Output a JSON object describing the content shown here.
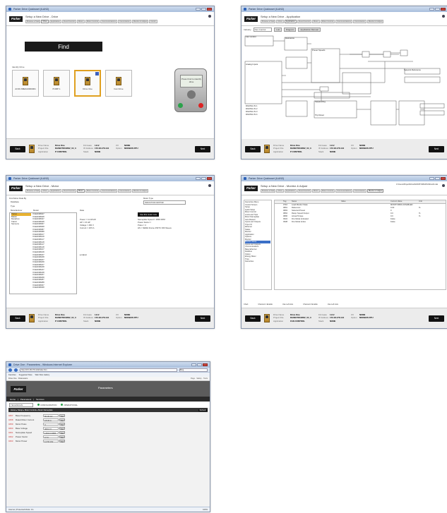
{
  "w1": {
    "title": "Parker Drive Quicksset (ILAN3)",
    "subtitle": "Setup a New Drive - Drive",
    "tabs": [
      "Browse a Task",
      "Drive",
      "Application",
      "Fixed Control",
      "Motor",
      "Motor Control",
      "Communications",
      "Commission",
      "Monitor & Adjust",
      "Finish"
    ],
    "find": "Find",
    "identify": "Identify Drive",
    "tiles": [
      "AC30-S8E0A0000001",
      "PUMP 1",
      "Drive One",
      "Fan Drive"
    ],
    "keypad": "Press Find to identify drive"
  },
  "w2": {
    "title": "Parker Drive Quicksset (ILAN3)",
    "subtitle": "Setup a New Drive - Application",
    "industry_label": "Industry",
    "industry": "Fan Control",
    "list_btn": "List",
    "diagram_btn": "Diagram",
    "manual_btn": "Application Manual",
    "fan_control": "Fan Control",
    "reference": "Reference",
    "preset_speeds": "Preset Speeds",
    "sequencing": "Sequencing",
    "trip_reset": "Trip Reset",
    "setpoint": "Setpoint Reference",
    "digital_inputs": [
      "DIGITAL IN 1",
      "DIGITAL IN 2",
      "DIGITAL IN 3",
      "DIGITAL IN 4"
    ],
    "analog": "Analog Inputs"
  },
  "w3": {
    "title": "Parker Drive Quicksset (ILAN3)",
    "subtitle": "Setup a New Drive - Motor",
    "search_hdr": "Find Motor Data By",
    "search_opts": [
      "Database",
      "Type"
    ],
    "motor_type_hdr": "Motor Type",
    "motor_type": "INDUCTION MOTOR",
    "col_manufacturer": "Manufacturer",
    "col_model": "Model",
    "col_data": "Data",
    "manufacturers": [
      "Parker",
      "Baldor",
      "Marathon",
      "TECO",
      "Siemens"
    ],
    "models": [
      "XCE4008027",
      "XCE4008028",
      "XCE4008047",
      "XCE4008048",
      "XCE4008067",
      "XCE4008068",
      "XCE4008087",
      "XCE4008088",
      "XCE4008107",
      "XCE4008108",
      "XCE4008127",
      "XCE4008128",
      "XCE4008147",
      "XCE4008148",
      "XCE4008167",
      "XCE4008168",
      "XCE4008187",
      "XCE4008188",
      "XCE4008207",
      "XCE4008208",
      "XCE4008227",
      "XCE4008228",
      "XCE4008247",
      "XCE4008248",
      "XCE4008267",
      "XCE4008268",
      "XCE4008287",
      "XCE4008288",
      "XCE4008307",
      "XCE4008308"
    ],
    "data_left": [
      "Power = 11.18 kW",
      "HP = 15 HP",
      "Voltage = 460 V",
      "Current = 18.5 A"
    ],
    "data_right": [
      "Nameplate Speed = 1800 RPM",
      "Power Factor =",
      "Poles = 4",
      "HS = NEMA Frame 254TC DIN Sleeve"
    ],
    "adjust": "Adjust",
    "nameplate_btn": "Use this motor now"
  },
  "w4": {
    "title": "Parker Drive Quicksset (ILAN3)",
    "subtitle": "Setup a New Drive - Monitor & Adjust",
    "path": "C:\\Users\\Project\\Drive\\MONITORDATA\\Drive01.dat",
    "tree": [
      "Favourites Menu",
      "Control Screen",
      "Setup",
      "Quick Setup",
      "Motor Control",
      "Limits and Trips",
      "Motor Nameplate",
      "Auto Restart",
      "Inputs and Outputs",
      "Trips I/O",
      "Ethernet",
      "Status",
      "Monitor",
      "Application",
      "Options",
      "Monitor",
      "Monitor Setup",
      "Inputs and Outputs",
      "Communications",
      "Base Ethernet",
      "Fieldbus",
      "Option",
      "Energy Meter",
      "Trips",
      "Favourites"
    ],
    "cols": [
      "Tag",
      "Name",
      "Value",
      "Current Value",
      "Unit"
    ],
    "rows": [
      [
        "0710",
        "Load Monitor State",
        "",
        "MONITORING DISABLED",
        ""
      ],
      [
        "0891",
        "Reference",
        "",
        "0.00",
        "%"
      ],
      [
        "0893",
        "Selected Preset",
        "",
        "0",
        ""
      ],
      [
        "0894",
        "Ramp Speed Output",
        "",
        "0.0",
        "%"
      ],
      [
        "0896",
        "Actual Torque",
        "",
        "0.0",
        "%"
      ],
      [
        "0934",
        "Fire Mode Activated",
        "",
        "False",
        ""
      ],
      [
        "0938",
        "Fire Mode Active",
        "",
        "False",
        ""
      ]
    ],
    "bottom": [
      "Chart",
      "Channel 1 Enable",
      "Use Left Axis",
      "Channel 2 Enable",
      "Use Left Axis"
    ]
  },
  "footer": {
    "back": "Back",
    "next": "Next",
    "drive_name_k": "Drive Name",
    "drive_name_v": "Drive One",
    "project_file_k": "Project File",
    "project_file_v": "RAINOTOUMO2_04_3",
    "application_k": "Application",
    "application_v": "P CONTROL",
    "firmware_k": "Firmware",
    "firmware_v": "1.8.2",
    "ip_k": "IP Address",
    "ip_v": "172.18.176.144",
    "stack_k": "Stack",
    "stack_v": "NONE",
    "io_k": "I/O",
    "io_v": "NONE",
    "option_k": "Option",
    "option_v": "MODBUS RTU",
    "app_v4": "FAN CONTROL"
  },
  "w5": {
    "title": "Drive One : Parameters - Windows Internet Explorer",
    "url": "http://172.18.176.144/index.htm",
    "search": "Bing",
    "favourites": [
      "Favorites",
      "Suggested Sites",
      "Web Slice Gallery"
    ],
    "tab": "Drive One : Parameters",
    "tools": [
      "Page",
      "Safety",
      "Tools"
    ],
    "banner_title": "Parameters",
    "nav": [
      "Home",
      "Parameters",
      "Services"
    ],
    "user": "TECHNICIAN",
    "status1": "CONFIGURATION",
    "status2": "OPERATIONAL",
    "crumb": "Home ▸ Setup ▸ Motor Control ▸ Motor Nameplate",
    "refresh": "Refresh",
    "params": [
      [
        "0457",
        "Base Frequency",
        "50.00 Hz"
      ],
      [
        "0458",
        "Rated Motor Current",
        "18.00 A"
      ],
      [
        "0459",
        "Motor Poles",
        "4"
      ],
      [
        "0460",
        "Base Voltage",
        "400.0 V"
      ],
      [
        "0461",
        "Nameplate Speed",
        "1450.0 RPM"
      ],
      [
        "0462",
        "Power Factor",
        "0.74"
      ],
      [
        "0463",
        "Motor Power",
        "14.50 kW"
      ]
    ],
    "set": "Set",
    "status_zone": "Internet | Protected Mode: On",
    "zoom": "100%"
  }
}
